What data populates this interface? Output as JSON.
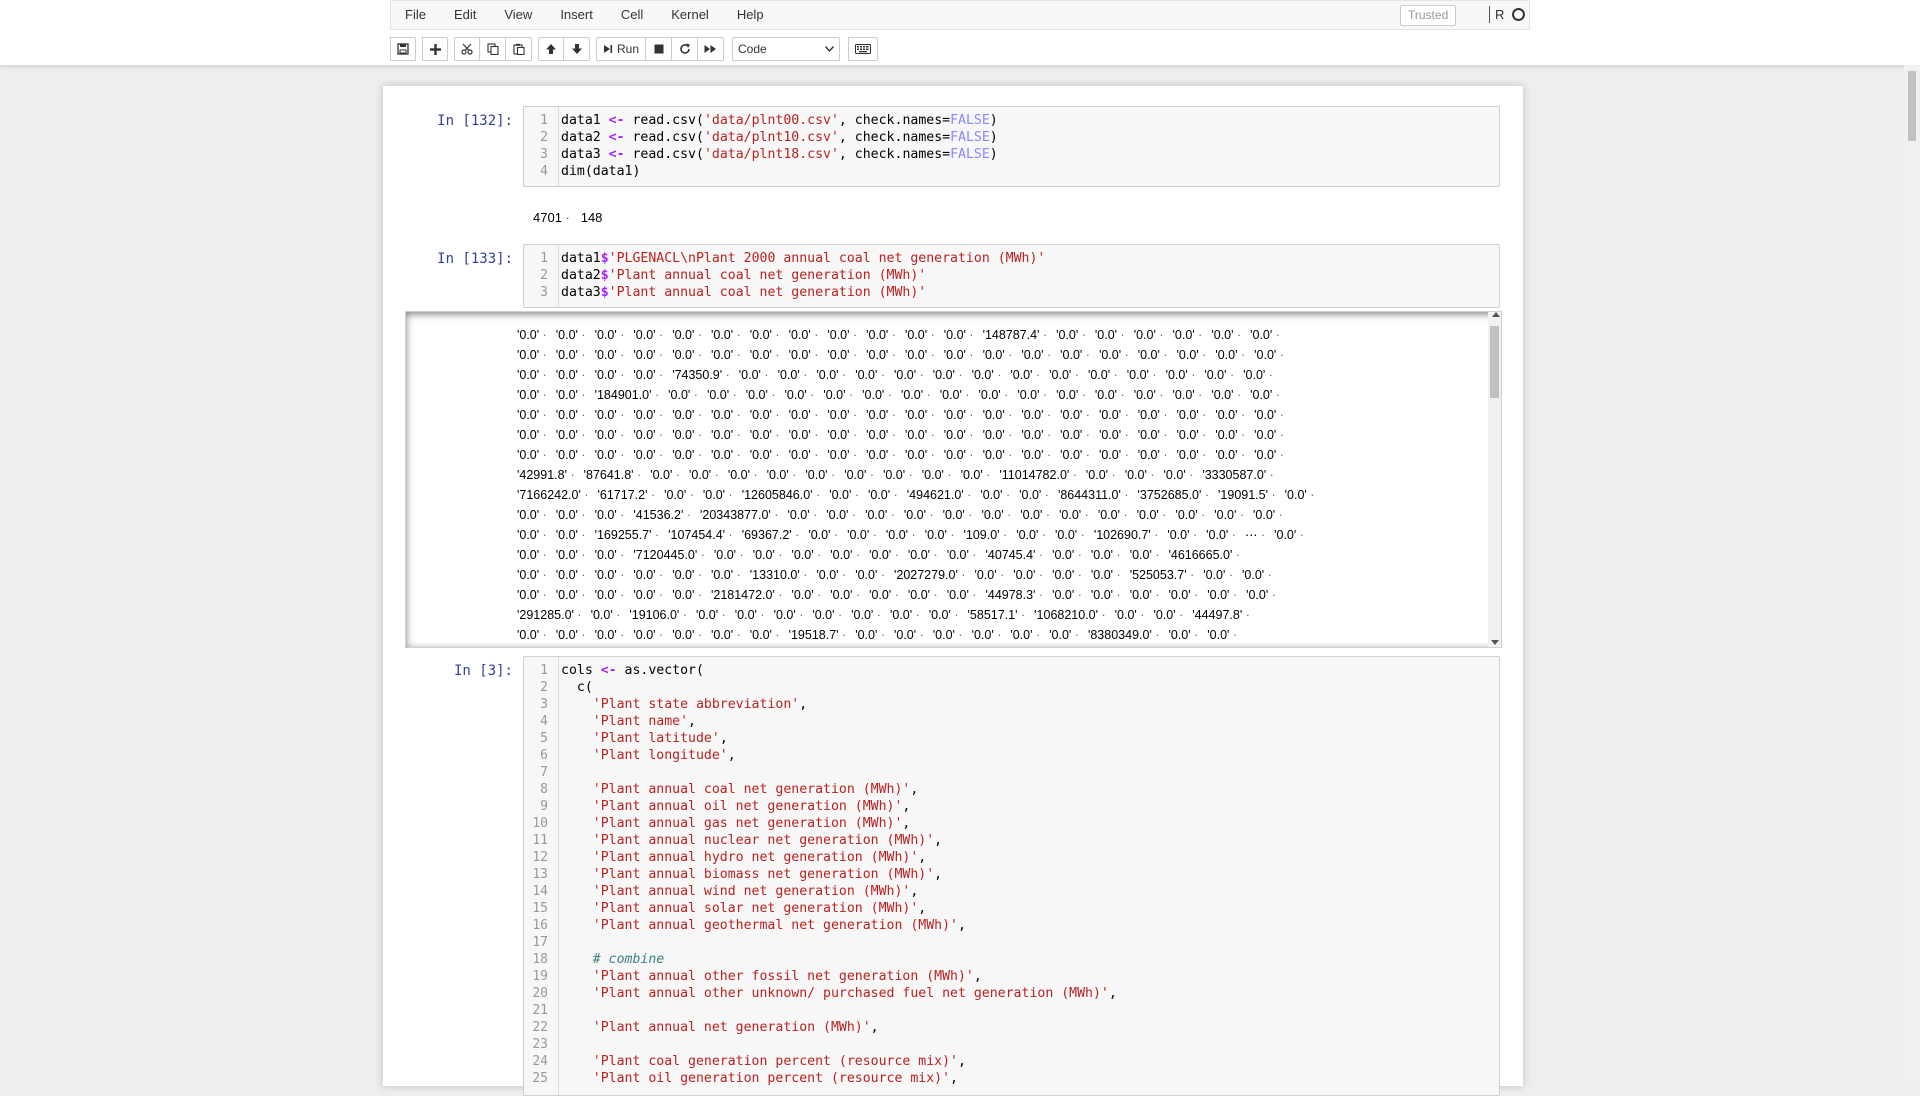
{
  "menu": [
    "File",
    "Edit",
    "View",
    "Insert",
    "Cell",
    "Kernel",
    "Help"
  ],
  "trusted_label": "Trusted",
  "kernel_name": "R",
  "toolbar": {
    "run_label": "Run",
    "cell_type": "Code"
  },
  "cells": [
    {
      "prompt": "In [132]:",
      "lines": [
        {
          "n": "1",
          "parts": [
            [
              "",
              "data1 "
            ],
            [
              "op",
              "<-"
            ],
            [
              "",
              " read.csv("
            ],
            [
              "str",
              "'data/plnt00.csv'"
            ],
            [
              "",
              ", check.names="
            ],
            [
              "kw",
              "FALSE"
            ],
            [
              "",
              ")"
            ]
          ]
        },
        {
          "n": "2",
          "parts": [
            [
              "",
              "data2 "
            ],
            [
              "op",
              "<-"
            ],
            [
              "",
              " read.csv("
            ],
            [
              "str",
              "'data/plnt10.csv'"
            ],
            [
              "",
              ", check.names="
            ],
            [
              "kw",
              "FALSE"
            ],
            [
              "",
              ")"
            ]
          ]
        },
        {
          "n": "3",
          "parts": [
            [
              "",
              "data3 "
            ],
            [
              "op",
              "<-"
            ],
            [
              "",
              " read.csv("
            ],
            [
              "str",
              "'data/plnt18.csv'"
            ],
            [
              "",
              ", check.names="
            ],
            [
              "kw",
              "FALSE"
            ],
            [
              "",
              ")"
            ]
          ]
        },
        {
          "n": "4",
          "parts": [
            [
              "",
              "dim(data1)"
            ]
          ]
        }
      ]
    },
    {
      "prompt": "In [133]:",
      "lines": [
        {
          "n": "1",
          "parts": [
            [
              "",
              "data1"
            ],
            [
              "op",
              "$"
            ],
            [
              "str",
              "'PLGENACL\\nPlant 2000 annual coal net generation (MWh)'"
            ]
          ]
        },
        {
          "n": "2",
          "parts": [
            [
              "",
              "data2"
            ],
            [
              "op",
              "$"
            ],
            [
              "str",
              "'Plant annual coal net generation (MWh)'"
            ]
          ]
        },
        {
          "n": "3",
          "parts": [
            [
              "",
              "data3"
            ],
            [
              "op",
              "$"
            ],
            [
              "str",
              "'Plant annual coal net generation (MWh)'"
            ]
          ]
        }
      ]
    },
    {
      "prompt": "In [3]:",
      "lines": [
        {
          "n": "1",
          "parts": [
            [
              "",
              "cols "
            ],
            [
              "op",
              "<-"
            ],
            [
              "",
              " as.vector("
            ]
          ]
        },
        {
          "n": "2",
          "parts": [
            [
              "",
              "  c("
            ]
          ]
        },
        {
          "n": "3",
          "parts": [
            [
              "",
              "    "
            ],
            [
              "str",
              "'Plant state abbreviation'"
            ],
            [
              "",
              ","
            ]
          ]
        },
        {
          "n": "4",
          "parts": [
            [
              "",
              "    "
            ],
            [
              "str",
              "'Plant name'"
            ],
            [
              "",
              ","
            ]
          ]
        },
        {
          "n": "5",
          "parts": [
            [
              "",
              "    "
            ],
            [
              "str",
              "'Plant latitude'"
            ],
            [
              "",
              ","
            ]
          ]
        },
        {
          "n": "6",
          "parts": [
            [
              "",
              "    "
            ],
            [
              "str",
              "'Plant longitude'"
            ],
            [
              "",
              ","
            ]
          ]
        },
        {
          "n": "7",
          "parts": [
            [
              "",
              ""
            ]
          ]
        },
        {
          "n": "8",
          "parts": [
            [
              "",
              "    "
            ],
            [
              "str",
              "'Plant annual coal net generation (MWh)'"
            ],
            [
              "",
              ","
            ]
          ]
        },
        {
          "n": "9",
          "parts": [
            [
              "",
              "    "
            ],
            [
              "str",
              "'Plant annual oil net generation (MWh)'"
            ],
            [
              "",
              ","
            ]
          ]
        },
        {
          "n": "10",
          "parts": [
            [
              "",
              "    "
            ],
            [
              "str",
              "'Plant annual gas net generation (MWh)'"
            ],
            [
              "",
              ","
            ]
          ]
        },
        {
          "n": "11",
          "parts": [
            [
              "",
              "    "
            ],
            [
              "str",
              "'Plant annual nuclear net generation (MWh)'"
            ],
            [
              "",
              ","
            ]
          ]
        },
        {
          "n": "12",
          "parts": [
            [
              "",
              "    "
            ],
            [
              "str",
              "'Plant annual hydro net generation (MWh)'"
            ],
            [
              "",
              ","
            ]
          ]
        },
        {
          "n": "13",
          "parts": [
            [
              "",
              "    "
            ],
            [
              "str",
              "'Plant annual biomass net generation (MWh)'"
            ],
            [
              "",
              ","
            ]
          ]
        },
        {
          "n": "14",
          "parts": [
            [
              "",
              "    "
            ],
            [
              "str",
              "'Plant annual wind net generation (MWh)'"
            ],
            [
              "",
              ","
            ]
          ]
        },
        {
          "n": "15",
          "parts": [
            [
              "",
              "    "
            ],
            [
              "str",
              "'Plant annual solar net generation (MWh)'"
            ],
            [
              "",
              ","
            ]
          ]
        },
        {
          "n": "16",
          "parts": [
            [
              "",
              "    "
            ],
            [
              "str",
              "'Plant annual geothermal net generation (MWh)'"
            ],
            [
              "",
              ","
            ]
          ]
        },
        {
          "n": "17",
          "parts": [
            [
              "",
              ""
            ]
          ]
        },
        {
          "n": "18",
          "parts": [
            [
              "",
              "    "
            ],
            [
              "cm",
              "# combine"
            ]
          ]
        },
        {
          "n": "19",
          "parts": [
            [
              "",
              "    "
            ],
            [
              "str",
              "'Plant annual other fossil net generation (MWh)'"
            ],
            [
              "",
              ","
            ]
          ]
        },
        {
          "n": "20",
          "parts": [
            [
              "",
              "    "
            ],
            [
              "str",
              "'Plant annual other unknown/ purchased fuel net generation (MWh)'"
            ],
            [
              "",
              ","
            ]
          ]
        },
        {
          "n": "21",
          "parts": [
            [
              "",
              ""
            ]
          ]
        },
        {
          "n": "22",
          "parts": [
            [
              "",
              "    "
            ],
            [
              "str",
              "'Plant annual net generation (MWh)'"
            ],
            [
              "",
              ","
            ]
          ]
        },
        {
          "n": "23",
          "parts": [
            [
              "",
              ""
            ]
          ]
        },
        {
          "n": "24",
          "parts": [
            [
              "",
              "    "
            ],
            [
              "str",
              "'Plant coal generation percent (resource mix)'"
            ],
            [
              "",
              ","
            ]
          ]
        },
        {
          "n": "25",
          "parts": [
            [
              "",
              "    "
            ],
            [
              "str",
              "'Plant oil generation percent (resource mix)'"
            ],
            [
              "",
              ","
            ]
          ]
        }
      ]
    }
  ],
  "dim_output": [
    "4701",
    "148"
  ],
  "output_rows": [
    [
      "'0.0'",
      "'0.0'",
      "'0.0'",
      "'0.0'",
      "'0.0'",
      "'0.0'",
      "'0.0'",
      "'0.0'",
      "'0.0'",
      "'0.0'",
      "'0.0'",
      "'0.0'",
      "'148787.4'",
      "'0.0'",
      "'0.0'",
      "'0.0'",
      "'0.0'",
      "'0.0'",
      "'0.0'"
    ],
    [
      "'0.0'",
      "'0.0'",
      "'0.0'",
      "'0.0'",
      "'0.0'",
      "'0.0'",
      "'0.0'",
      "'0.0'",
      "'0.0'",
      "'0.0'",
      "'0.0'",
      "'0.0'",
      "'0.0'",
      "'0.0'",
      "'0.0'",
      "'0.0'",
      "'0.0'",
      "'0.0'",
      "'0.0'",
      "'0.0'"
    ],
    [
      "'0.0'",
      "'0.0'",
      "'0.0'",
      "'0.0'",
      "'74350.9'",
      "'0.0'",
      "'0.0'",
      "'0.0'",
      "'0.0'",
      "'0.0'",
      "'0.0'",
      "'0.0'",
      "'0.0'",
      "'0.0'",
      "'0.0'",
      "'0.0'",
      "'0.0'",
      "'0.0'",
      "'0.0'"
    ],
    [
      "'0.0'",
      "'0.0'",
      "'184901.0'",
      "'0.0'",
      "'0.0'",
      "'0.0'",
      "'0.0'",
      "'0.0'",
      "'0.0'",
      "'0.0'",
      "'0.0'",
      "'0.0'",
      "'0.0'",
      "'0.0'",
      "'0.0'",
      "'0.0'",
      "'0.0'",
      "'0.0'",
      "'0.0'"
    ],
    [
      "'0.0'",
      "'0.0'",
      "'0.0'",
      "'0.0'",
      "'0.0'",
      "'0.0'",
      "'0.0'",
      "'0.0'",
      "'0.0'",
      "'0.0'",
      "'0.0'",
      "'0.0'",
      "'0.0'",
      "'0.0'",
      "'0.0'",
      "'0.0'",
      "'0.0'",
      "'0.0'",
      "'0.0'",
      "'0.0'"
    ],
    [
      "'0.0'",
      "'0.0'",
      "'0.0'",
      "'0.0'",
      "'0.0'",
      "'0.0'",
      "'0.0'",
      "'0.0'",
      "'0.0'",
      "'0.0'",
      "'0.0'",
      "'0.0'",
      "'0.0'",
      "'0.0'",
      "'0.0'",
      "'0.0'",
      "'0.0'",
      "'0.0'",
      "'0.0'",
      "'0.0'"
    ],
    [
      "'0.0'",
      "'0.0'",
      "'0.0'",
      "'0.0'",
      "'0.0'",
      "'0.0'",
      "'0.0'",
      "'0.0'",
      "'0.0'",
      "'0.0'",
      "'0.0'",
      "'0.0'",
      "'0.0'",
      "'0.0'",
      "'0.0'",
      "'0.0'",
      "'0.0'",
      "'0.0'",
      "'0.0'",
      "'0.0'"
    ],
    [
      "'42991.8'",
      "'87641.8'",
      "'0.0'",
      "'0.0'",
      "'0.0'",
      "'0.0'",
      "'0.0'",
      "'0.0'",
      "'0.0'",
      "'0.0'",
      "'0.0'",
      "'11014782.0'",
      "'0.0'",
      "'0.0'",
      "'0.0'",
      "'3330587.0'"
    ],
    [
      "'7166242.0'",
      "'61717.2'",
      "'0.0'",
      "'0.0'",
      "'12605846.0'",
      "'0.0'",
      "'0.0'",
      "'494621.0'",
      "'0.0'",
      "'0.0'",
      "'8644311.0'",
      "'3752685.0'",
      "'19091.5'",
      "'0.0'"
    ],
    [
      "'0.0'",
      "'0.0'",
      "'0.0'",
      "'41536.2'",
      "'20343877.0'",
      "'0.0'",
      "'0.0'",
      "'0.0'",
      "'0.0'",
      "'0.0'",
      "'0.0'",
      "'0.0'",
      "'0.0'",
      "'0.0'",
      "'0.0'",
      "'0.0'",
      "'0.0'",
      "'0.0'"
    ],
    [
      "'0.0'",
      "'0.0'",
      "'169255.7'",
      "'107454.4'",
      "'69367.2'",
      "'0.0'",
      "'0.0'",
      "'0.0'",
      "'0.0'",
      "'109.0'",
      "'0.0'",
      "'0.0'",
      "'102690.7'",
      "'0.0'",
      "'0.0'",
      "⋯",
      "'0.0'"
    ],
    [
      "'0.0'",
      "'0.0'",
      "'0.0'",
      "'7120445.0'",
      "'0.0'",
      "'0.0'",
      "'0.0'",
      "'0.0'",
      "'0.0'",
      "'0.0'",
      "'0.0'",
      "'40745.4'",
      "'0.0'",
      "'0.0'",
      "'0.0'",
      "'4616665.0'"
    ],
    [
      "'0.0'",
      "'0.0'",
      "'0.0'",
      "'0.0'",
      "'0.0'",
      "'0.0'",
      "'13310.0'",
      "'0.0'",
      "'0.0'",
      "'2027279.0'",
      "'0.0'",
      "'0.0'",
      "'0.0'",
      "'0.0'",
      "'525053.7'",
      "'0.0'",
      "'0.0'"
    ],
    [
      "'0.0'",
      "'0.0'",
      "'0.0'",
      "'0.0'",
      "'0.0'",
      "'2181472.0'",
      "'0.0'",
      "'0.0'",
      "'0.0'",
      "'0.0'",
      "'0.0'",
      "'44978.3'",
      "'0.0'",
      "'0.0'",
      "'0.0'",
      "'0.0'",
      "'0.0'",
      "'0.0'"
    ],
    [
      "'291285.0'",
      "'0.0'",
      "'19106.0'",
      "'0.0'",
      "'0.0'",
      "'0.0'",
      "'0.0'",
      "'0.0'",
      "'0.0'",
      "'0.0'",
      "'58517.1'",
      "'1068210.0'",
      "'0.0'",
      "'0.0'",
      "'44497.8'"
    ],
    [
      "'0.0'",
      "'0.0'",
      "'0.0'",
      "'0.0'",
      "'0.0'",
      "'0.0'",
      "'0.0'",
      "'19518.7'",
      "'0.0'",
      "'0.0'",
      "'0.0'",
      "'0.0'",
      "'0.0'",
      "'0.0'",
      "'8380349.0'",
      "'0.0'",
      "'0.0'"
    ]
  ]
}
